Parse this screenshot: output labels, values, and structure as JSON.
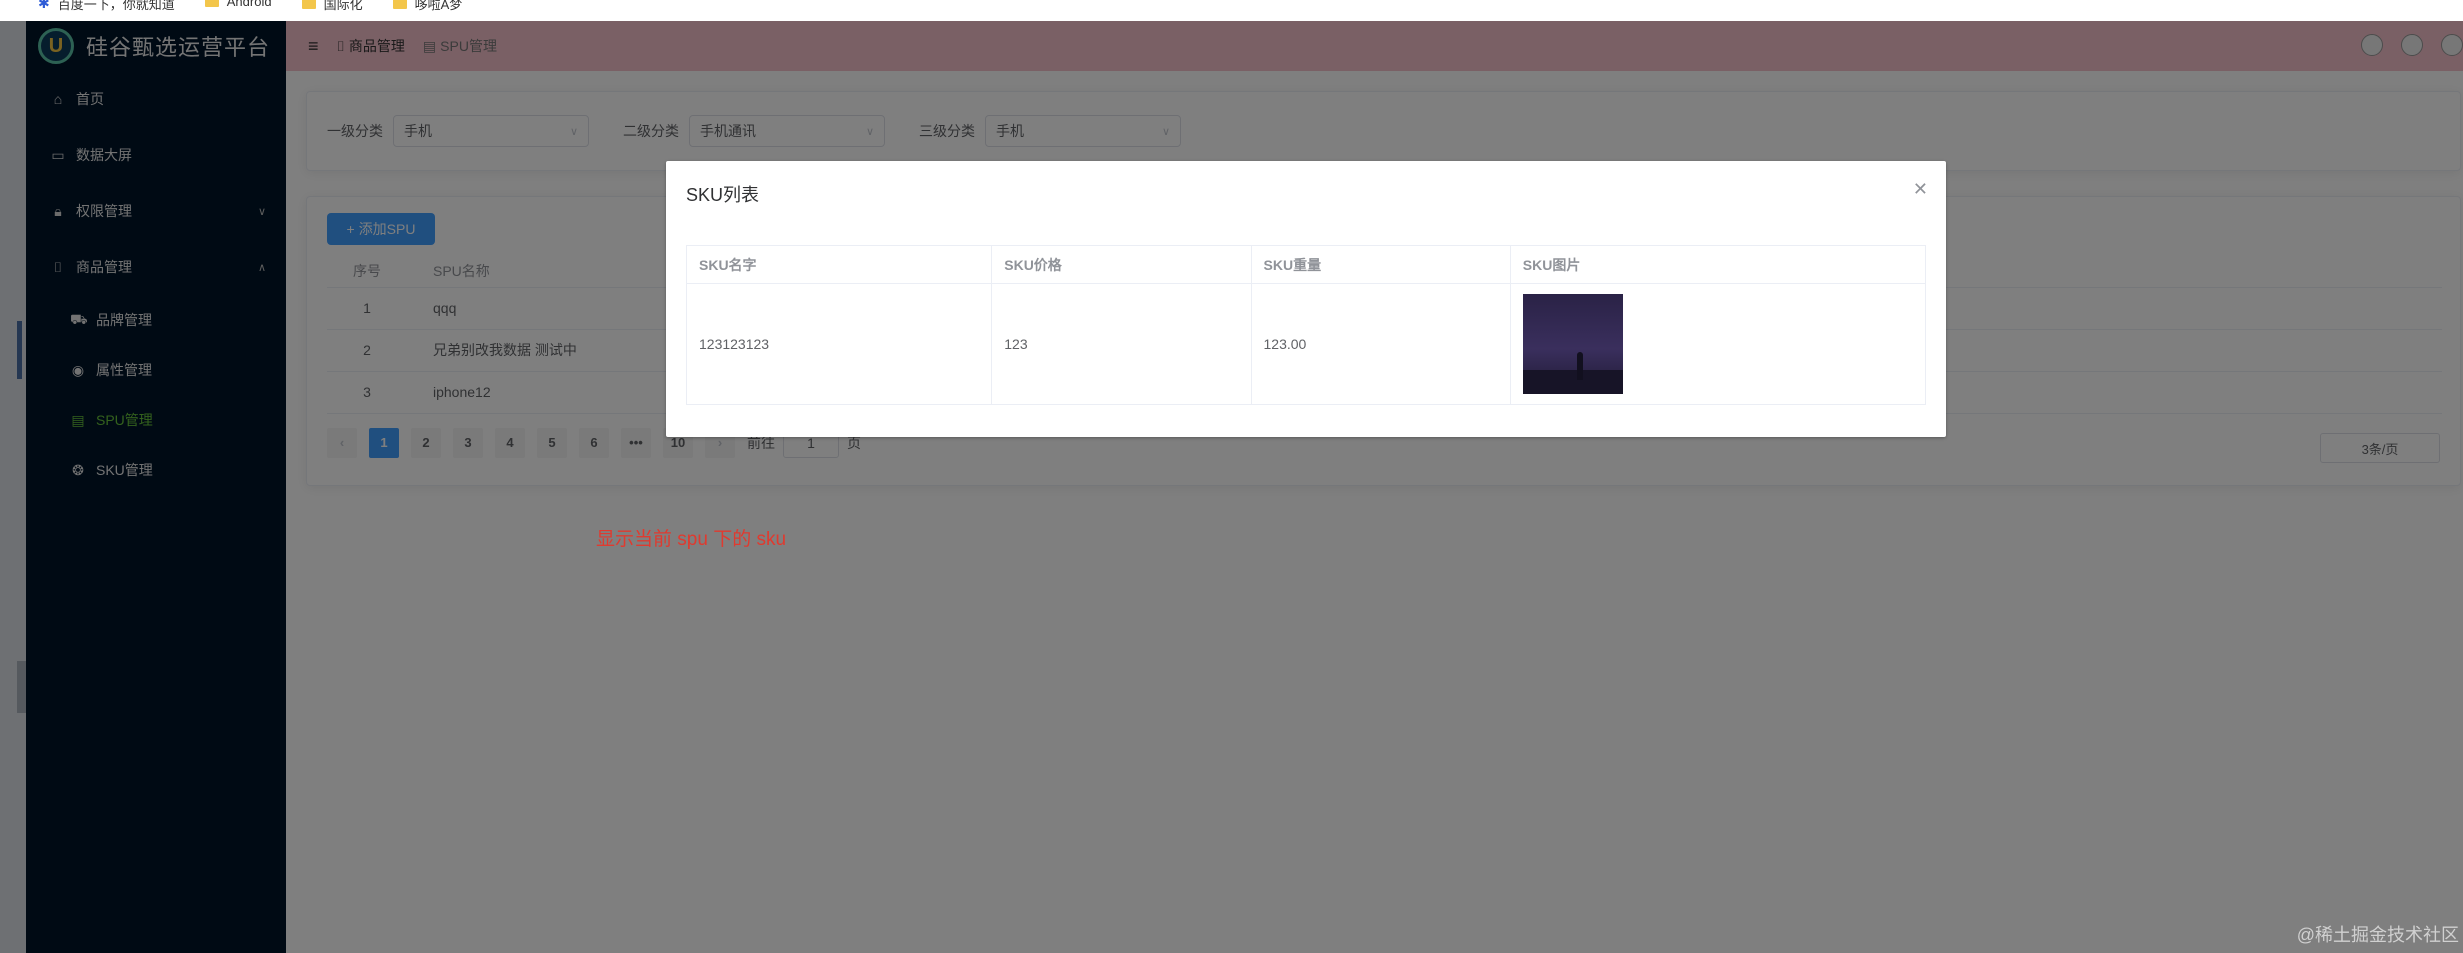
{
  "bookmarks": [
    {
      "label": "百度一下，你就知道",
      "icon": "paw-icon"
    },
    {
      "label": "Android",
      "icon": "folder-icon"
    },
    {
      "label": "国际化",
      "icon": "folder-icon"
    },
    {
      "label": "哆啦A梦",
      "icon": "folder-icon"
    }
  ],
  "app": {
    "title": "硅谷甄选运营平台",
    "logo_letter": "U"
  },
  "sidebar": {
    "items": [
      {
        "label": "首页",
        "icon": "home-icon"
      },
      {
        "label": "数据大屏",
        "icon": "monitor-icon"
      },
      {
        "label": "权限管理",
        "icon": "lock-icon"
      },
      {
        "label": "商品管理",
        "icon": "bag-icon"
      }
    ],
    "sub_items": [
      {
        "label": "品牌管理",
        "icon": "cart-icon"
      },
      {
        "label": "属性管理",
        "icon": "chrome-icon"
      },
      {
        "label": "SPU管理",
        "icon": "calendar-icon",
        "active": true
      },
      {
        "label": "SKU管理",
        "icon": "aperture-icon"
      }
    ]
  },
  "topbar": {
    "breadcrumb": [
      "商品管理",
      "SPU管理"
    ]
  },
  "filters": [
    {
      "label": "一级分类",
      "value": "手机"
    },
    {
      "label": "二级分类",
      "value": "手机通讯"
    },
    {
      "label": "三级分类",
      "value": "手机"
    }
  ],
  "spu": {
    "add_button": "添加SPU",
    "columns": [
      "序号",
      "SPU名称"
    ],
    "rows": [
      {
        "index": "1",
        "name": "qqq"
      },
      {
        "index": "2",
        "name": "兄弟别改我数据 测试中"
      },
      {
        "index": "3",
        "name": "iphone12"
      }
    ],
    "pagination": {
      "pages": [
        "1",
        "2",
        "3",
        "4",
        "5",
        "6",
        "•••",
        "10"
      ],
      "current": "1",
      "goto_label": "前往",
      "goto_value": "1",
      "page_unit": "页",
      "page_size": "3条/页"
    }
  },
  "dialog": {
    "title": "SKU列表",
    "columns": [
      "SKU名字",
      "SKU价格",
      "SKU重量",
      "SKU图片"
    ],
    "rows": [
      {
        "name": "123123123",
        "price": "123",
        "weight": "123.00"
      }
    ]
  },
  "note": "显示当前 spu 下的 sku",
  "watermark": "@稀土掘金技术社区",
  "colors": {
    "accent": "#409eff",
    "sidebar_bg": "#001529",
    "topbar_bg": "#f4c1cb",
    "active_menu": "#67c23a",
    "note": "#e03a2f"
  }
}
